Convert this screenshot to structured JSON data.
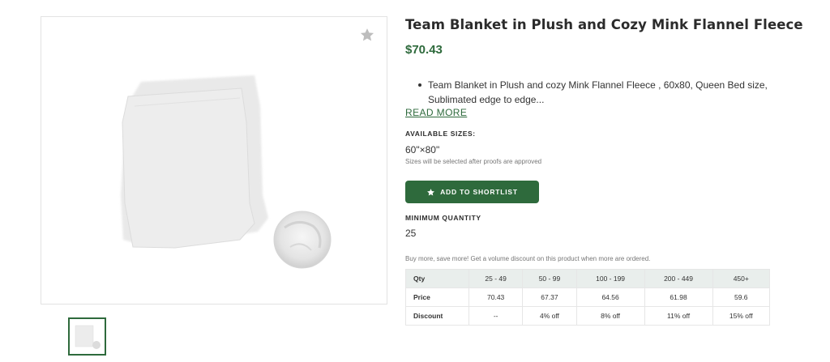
{
  "product": {
    "title": "Team Blanket in Plush and Cozy Mink Flannel Fleece",
    "price": "$70.43",
    "description": "Team Blanket in Plush and cozy Mink Flannel Fleece , 60x80, Queen Bed size, Sublimated edge to edge...",
    "read_more": "READ MORE"
  },
  "sizes": {
    "label": "AVAILABLE SIZES:",
    "value": "60\"×80\"",
    "note": "Sizes will be selected after proofs are approved"
  },
  "shortlist_button": {
    "label": "ADD TO SHORTLIST",
    "icon": "star-icon"
  },
  "minimum_quantity": {
    "label": "MINIMUM QUANTITY",
    "value": "25"
  },
  "volume_note": "Buy more, save more! Get a volume discount on this product when more are ordered.",
  "pricing_table": {
    "headers": [
      "Qty",
      "25 - 49",
      "50 - 99",
      "100 - 199",
      "200 - 449",
      "450+"
    ],
    "rows": [
      [
        "Price",
        "70.43",
        "67.37",
        "64.56",
        "61.98",
        "59.6"
      ],
      [
        "Discount",
        "--",
        "4% off",
        "8% off",
        "11% off",
        "15% off"
      ]
    ]
  },
  "gallery": {
    "favorite_icon": "star-icon",
    "thumbnail_count": 1
  },
  "colors": {
    "accent": "#2e6a3c",
    "table_header_bg": "#e9eeec"
  }
}
